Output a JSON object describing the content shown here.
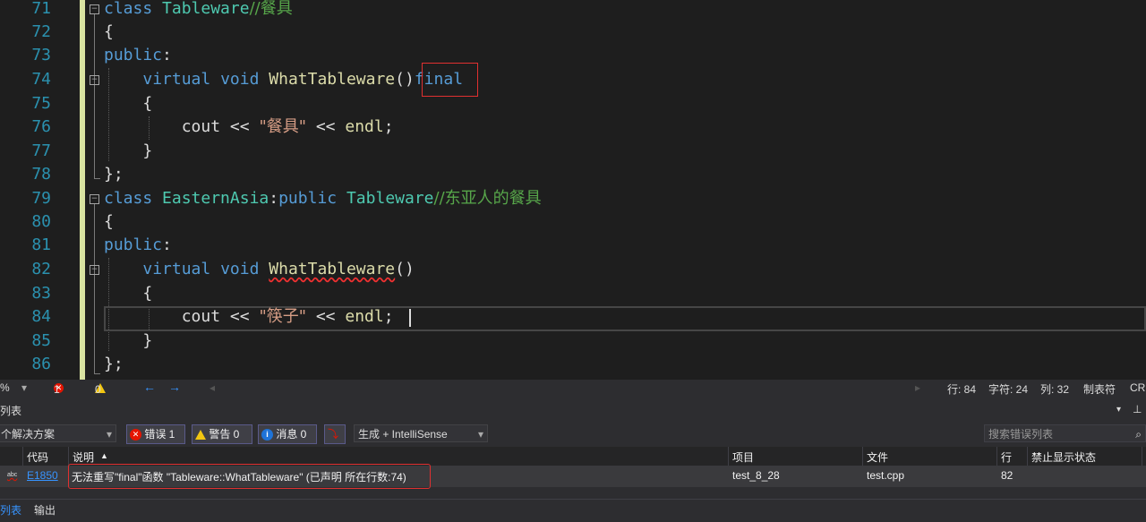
{
  "editor": {
    "line_numbers": [
      "71",
      "72",
      "73",
      "74",
      "75",
      "76",
      "77",
      "78",
      "79",
      "80",
      "81",
      "82",
      "83",
      "84",
      "85",
      "86"
    ],
    "l71_kw": "class",
    "l71_type": "Tableware",
    "l71_comment": "//餐具",
    "open_brace": "{",
    "close_brace_semi": "};",
    "public_kw": "public",
    "colon": ":",
    "virtual_kw": "virtual",
    "void_kw": "void",
    "fn_name": "WhatTableware",
    "parens": "()",
    "final_kw": "final",
    "cout": "cout",
    "shift": "<<",
    "endl": "endl",
    "semi": ";",
    "str1": "\"餐具\"",
    "str2": "\"筷子\"",
    "close_brace": "}",
    "l79_type": "EasternAsia",
    "l79_colon": ":",
    "l79_public": "public",
    "l79_base": "Tableware",
    "l79_comment": "//东亚人的餐具"
  },
  "status": {
    "zoom": "%",
    "errors": "1",
    "warnings": "0",
    "line": "行: 84",
    "char": "字符: 24",
    "col": "列: 32",
    "tabs": "制表符",
    "eol": "CRL"
  },
  "panel": {
    "title": "列表",
    "scope": "个解决方案",
    "errors_btn": "错误 1",
    "warnings_btn": "警告 0",
    "messages_btn": "消息 0",
    "build_filter": "生成 + IntelliSense",
    "search_placeholder": "搜索错误列表",
    "columns": {
      "code": "代码",
      "desc": "说明",
      "project": "项目",
      "file": "文件",
      "line": "行",
      "suppress": "禁止显示状态"
    },
    "row": {
      "code": "E1850",
      "desc": "无法重写\"final\"函数 \"Tableware::WhatTableware\" (已声明 所在行数:74)",
      "project": "test_8_28",
      "file": "test.cpp",
      "line": "82"
    },
    "tab_error_list": "列表",
    "tab_output": "输出"
  },
  "colors": {
    "keyword": "#569cd6",
    "type": "#4ec9b0",
    "function": "#dcdcaa",
    "comment": "#57a64a",
    "string": "#d69d85",
    "error": "#e51400"
  }
}
